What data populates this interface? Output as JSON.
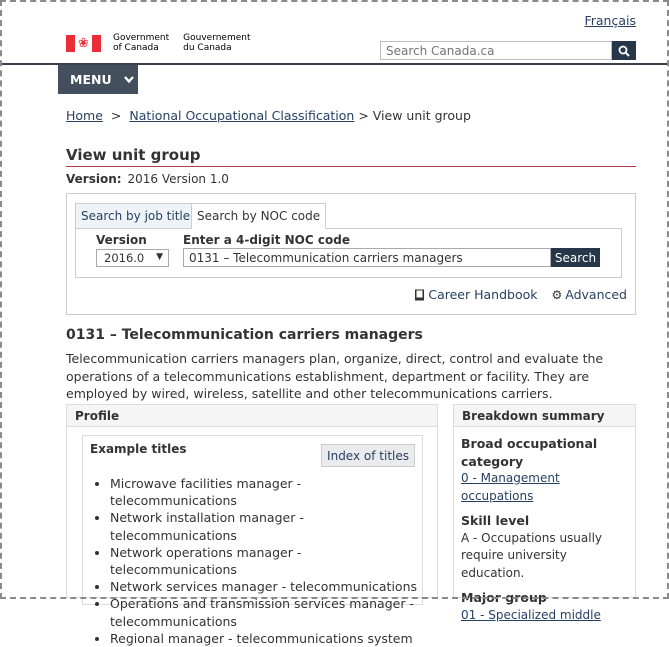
{
  "header": {
    "language_link": "Français",
    "signature_en_line1": "Government",
    "signature_en_line2": "of Canada",
    "signature_fr_line1": "Gouvernement",
    "signature_fr_line2": "du Canada",
    "search_placeholder": "Search Canada.ca",
    "menu_label": "MENU"
  },
  "breadcrumb": {
    "home": "Home",
    "noc": "National Occupational Classification",
    "current": "> View unit group",
    "separator": ">"
  },
  "page": {
    "title": "View unit group",
    "version_label": "Version:",
    "version_value": "2016 Version 1.0"
  },
  "search_panel": {
    "tab_job_title": "Search by job title",
    "tab_noc_code": "Search by NOC code",
    "version_label": "Version",
    "version_selected": "2016.0",
    "noc_label": "Enter a 4-digit NOC code",
    "noc_value": "0131 – Telecommunication carriers managers",
    "search_button": "Search",
    "career_handbook": "Career Handbook",
    "advanced": "Advanced"
  },
  "noc": {
    "title": "0131 – Telecommunication carriers managers",
    "description": "Telecommunication carriers managers plan, organize, direct, control and evaluate the operations of a telecommunications establishment, department or facility. They are employed by wired, wireless, satellite and other telecommunications carriers."
  },
  "profile": {
    "heading": "Profile",
    "example_titles_heading": "Example titles",
    "index_button": "Index of titles",
    "examples": [
      "Microwave facilities manager - telecommunications",
      "Network installation manager - telecommunications",
      "Network operations manager - telecommunications",
      "Network services manager - telecommunications",
      "Operations and transmission services manager - telecommunications",
      "Regional manager - telecommunications system"
    ]
  },
  "breakdown": {
    "heading": "Breakdown summary",
    "broad_heading": "Broad occupational category",
    "broad_link": "0 - Management occupations",
    "skill_heading": "Skill level",
    "skill_text": "A - Occupations usually require university education.",
    "major_heading": "Major group",
    "major_link": "01 - Specialized middle"
  },
  "colors": {
    "canada_red": "#eb2d37",
    "dark_navy": "#26374a",
    "title_rule": "#af3c43",
    "link": "#284162"
  }
}
